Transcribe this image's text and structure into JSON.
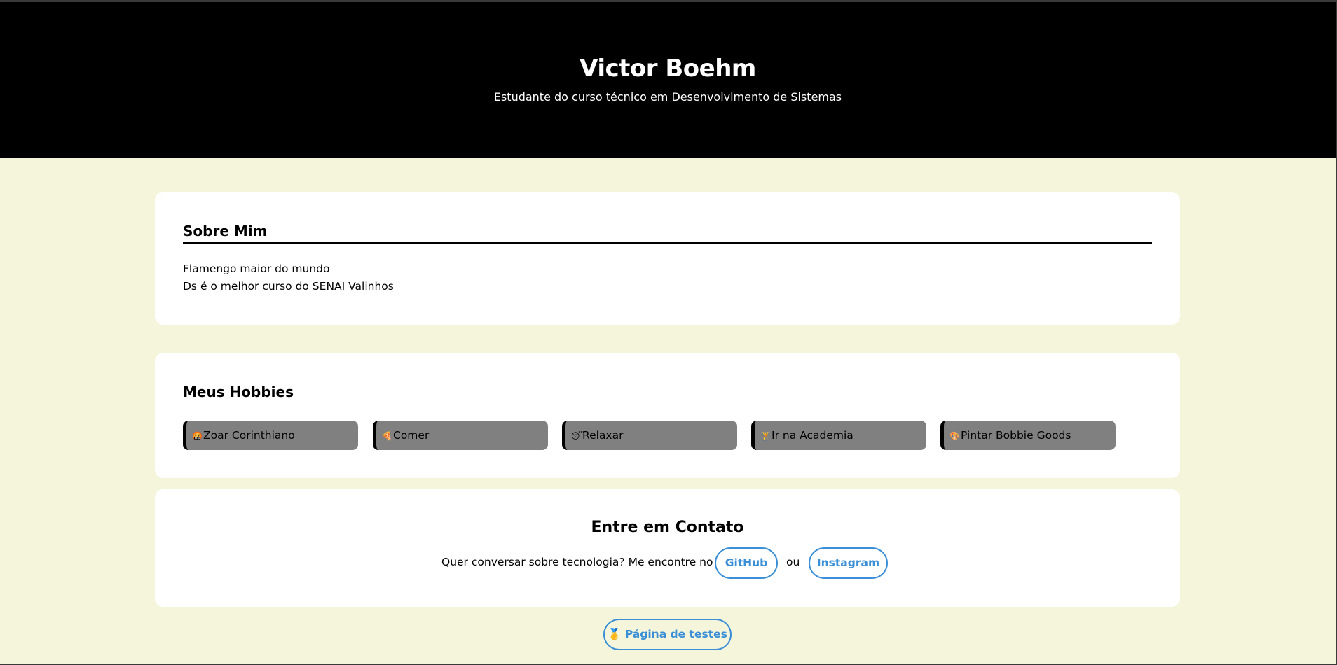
{
  "header": {
    "name": "Victor Boehm",
    "subtitle": "Estudante do curso técnico em Desenvolvimento de Sistemas"
  },
  "about": {
    "title": "Sobre Mim",
    "lines": [
      "Flamengo maior do mundo",
      "Ds é o melhor curso do SENAI Valinhos"
    ]
  },
  "hobbies": {
    "title": "Meus Hobbies",
    "items": [
      {
        "emoji": "🤬",
        "label": "Zoar Corinthiano"
      },
      {
        "emoji": "🍕",
        "label": "Comer"
      },
      {
        "emoji": "😴",
        "label": "Relaxar"
      },
      {
        "emoji": "🏋",
        "label": "Ir na Academia"
      },
      {
        "emoji": "🎨",
        "label": "Pintar Bobbie Goods"
      }
    ]
  },
  "contact": {
    "title": "Entre em Contato",
    "text": "Quer conversar sobre tecnologia? Me encontre no",
    "github_label": "GitHub",
    "separator": "ou",
    "instagram_label": "Instagram"
  },
  "test_page": {
    "emoji": "🥇",
    "label": "Página de testes"
  },
  "colors": {
    "background": "#f5f5dc",
    "header": "#000000",
    "accent": "#3a8fd6",
    "hobby_bg": "#808080"
  }
}
